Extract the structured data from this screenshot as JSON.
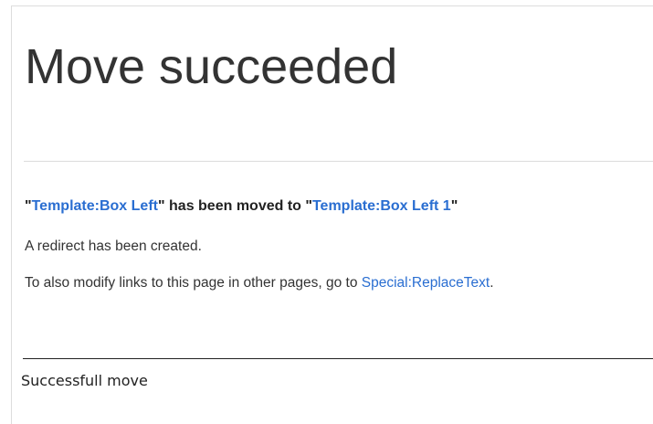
{
  "page": {
    "title": "Move succeeded"
  },
  "move_result": {
    "open_quote": "\"",
    "from_link": "Template:Box Left",
    "middle_text": "\" has been moved to \"",
    "to_link": "Template:Box Left 1",
    "close_quote": "\""
  },
  "notices": {
    "redirect": "A redirect has been created.",
    "replace_prefix": "To also modify links to this page in other pages, go to ",
    "replace_link": "Special:ReplaceText",
    "replace_suffix": "."
  },
  "caption": {
    "text": "Successfull move"
  },
  "colors": {
    "link": "#2a6ed1",
    "text": "#222222"
  }
}
